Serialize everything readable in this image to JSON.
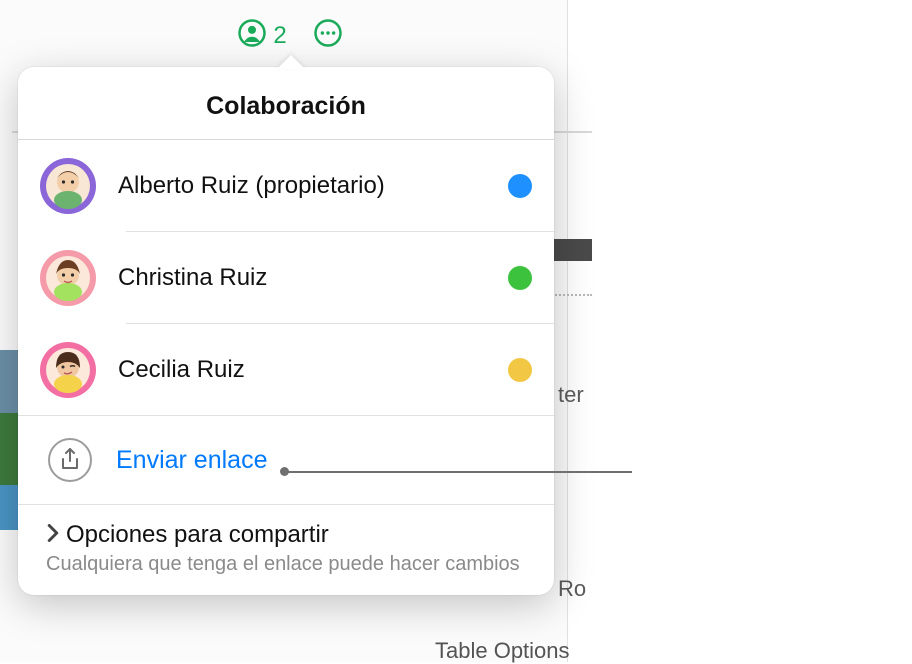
{
  "toolbar": {
    "collaborator_count": "2"
  },
  "popover": {
    "title": "Colaboración",
    "collaborators": [
      {
        "name": "Alberto Ruiz (propietario)",
        "avatar_ring": "#8a66d9",
        "dot": "#1e90ff"
      },
      {
        "name": "Christina Ruiz",
        "avatar_ring": "#f59aa8",
        "dot": "#3cc23c"
      },
      {
        "name": "Cecilia Ruiz",
        "avatar_ring": "#f26ea3",
        "dot": "#f2c744"
      }
    ],
    "send_link_label": "Enviar enlace",
    "share_options": {
      "title": "Opciones para compartir",
      "subtitle": "Cualquiera que tenga el enlace puede hacer cambios"
    }
  },
  "background": {
    "frag1": "ter",
    "frag2": "Ro",
    "frag3": "Table Options"
  }
}
